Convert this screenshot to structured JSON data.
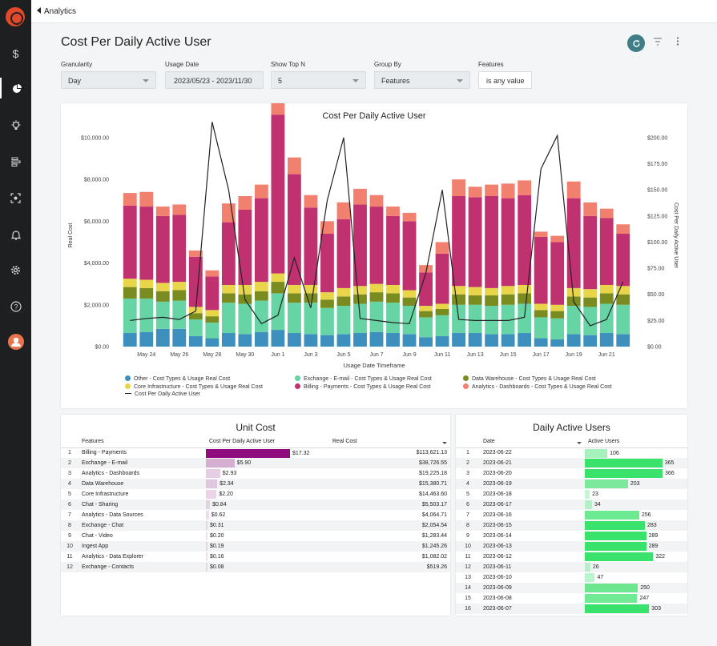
{
  "nav": {
    "back_label": "Analytics"
  },
  "page": {
    "title": "Cost Per Daily Active User"
  },
  "filters": [
    {
      "label": "Granularity",
      "value": "Day"
    },
    {
      "label": "Usage Date",
      "value": "2023/05/23 - 2023/11/30"
    },
    {
      "label": "Show Top N",
      "value": "5"
    },
    {
      "label": "Group By",
      "value": "Features"
    },
    {
      "label": "Features",
      "value": "is any value"
    }
  ],
  "colors": {
    "other": "#3d8fbd",
    "core_infrastructure": "#e8d54a",
    "exchange_email": "#67d4a6",
    "billing_payments": "#c0326f",
    "data_warehouse": "#7a8c20",
    "analytics_dashboards": "#f2806f",
    "accent": "#3f7e87",
    "unit_bar": "#8e0c7e",
    "dau_bar": "#39e26b"
  },
  "chart_data": {
    "type": "bar",
    "title": "Cost Per Daily Active User",
    "xlabel": "Usage Date Timeframe",
    "ylabel": "Real Cost",
    "y2label": "Cost Per Daily Active User",
    "ylim": [
      0,
      10800
    ],
    "y2lim": [
      0,
      216
    ],
    "y_ticks": [
      "$0.00",
      "$2,000.00",
      "$4,000.00",
      "$6,000.00",
      "$8,000.00",
      "$10,000.00"
    ],
    "y2_ticks": [
      "$0.00",
      "$25.00",
      "$50.00",
      "$75.00",
      "$100.00",
      "$125.00",
      "$150.00",
      "$175.00",
      "$200.00"
    ],
    "x_tick_labels": [
      "May 24",
      "May 26",
      "May 28",
      "May 30",
      "Jun 1",
      "Jun 3",
      "Jun 5",
      "Jun 7",
      "Jun 9",
      "Jun 11",
      "Jun 13",
      "Jun 15",
      "Jun 17",
      "Jun 19",
      "Jun 21"
    ],
    "x_tick_positions": [
      1,
      3,
      5,
      7,
      9,
      11,
      13,
      15,
      17,
      19,
      21,
      23,
      25,
      27,
      29
    ],
    "categories": [
      "2023-05-23",
      "2023-05-24",
      "2023-05-25",
      "2023-05-26",
      "2023-05-27",
      "2023-05-28",
      "2023-05-29",
      "2023-05-30",
      "2023-05-31",
      "2023-06-01",
      "2023-06-02",
      "2023-06-03",
      "2023-06-04",
      "2023-06-05",
      "2023-06-06",
      "2023-06-07",
      "2023-06-08",
      "2023-06-09",
      "2023-06-10",
      "2023-06-11",
      "2023-06-12",
      "2023-06-13",
      "2023-06-14",
      "2023-06-15",
      "2023-06-16",
      "2023-06-17",
      "2023-06-18",
      "2023-06-19",
      "2023-06-20",
      "2023-06-21",
      "2023-06-22"
    ],
    "stacked": true,
    "series": [
      {
        "name": "Other - Cost Types & Usage Real Cost",
        "color_key": "other",
        "values": [
          650,
          700,
          850,
          850,
          500,
          400,
          650,
          600,
          700,
          800,
          650,
          600,
          550,
          600,
          650,
          700,
          650,
          600,
          450,
          500,
          650,
          650,
          600,
          600,
          650,
          400,
          350,
          600,
          550,
          650,
          600
        ]
      },
      {
        "name": "Exchange - E-mail - Cost Types & Usage Real Cost",
        "color_key": "exchange_email",
        "values": [
          1650,
          1600,
          1300,
          1350,
          800,
          750,
          1450,
          1450,
          1500,
          1750,
          1450,
          1500,
          1300,
          1350,
          1400,
          1450,
          1450,
          1350,
          950,
          1000,
          1350,
          1350,
          1350,
          1400,
          1400,
          1000,
          1000,
          1350,
          1350,
          1400,
          1400
        ]
      },
      {
        "name": "Data Warehouse - Cost Types & Usage Real Cost",
        "color_key": "data_warehouse",
        "values": [
          550,
          500,
          500,
          500,
          300,
          300,
          450,
          450,
          450,
          550,
          450,
          450,
          400,
          450,
          450,
          450,
          450,
          400,
          300,
          300,
          500,
          450,
          500,
          500,
          500,
          350,
          350,
          450,
          450,
          500,
          500
        ]
      },
      {
        "name": "Core Infrastructure - Cost Types & Usage Real Cost",
        "color_key": "core_infrastructure",
        "values": [
          400,
          400,
          400,
          400,
          300,
          300,
          400,
          450,
          450,
          400,
          400,
          400,
          350,
          400,
          400,
          400,
          400,
          350,
          250,
          250,
          400,
          400,
          350,
          400,
          400,
          300,
          300,
          400,
          400,
          400,
          400
        ]
      },
      {
        "name": "Billing - Payments - Cost Types & Usage Real Cost",
        "color_key": "billing_payments",
        "values": [
          3500,
          3500,
          3200,
          3200,
          2400,
          1600,
          3000,
          3600,
          4000,
          7600,
          5300,
          3700,
          2800,
          3300,
          3900,
          3700,
          3300,
          3300,
          1600,
          2400,
          4300,
          4300,
          4400,
          4200,
          4300,
          3200,
          3000,
          4300,
          3500,
          3200,
          2500
        ]
      },
      {
        "name": "Analytics - Dashboards - Cost Types & Usage Real Cost",
        "color_key": "analytics_dashboards",
        "values": [
          600,
          700,
          450,
          500,
          300,
          300,
          900,
          650,
          650,
          600,
          800,
          600,
          600,
          800,
          750,
          550,
          450,
          400,
          350,
          550,
          800,
          500,
          550,
          700,
          700,
          250,
          300,
          800,
          650,
          450,
          450
        ]
      }
    ],
    "line_series": {
      "name": "Cost Per Daily Active User",
      "axis": "right",
      "values": [
        25,
        27,
        28,
        26,
        34,
        215,
        150,
        45,
        22,
        30,
        85,
        37,
        140,
        200,
        27,
        25,
        23,
        22,
        70,
        150,
        26,
        25,
        25,
        25,
        28,
        170,
        202,
        43,
        20,
        26,
        62
      ]
    }
  },
  "legend": [
    {
      "label": "Other - Cost Types & Usage Real Cost",
      "color_key": "other"
    },
    {
      "label": "Exchange - E-mail - Cost Types & Usage Real Cost",
      "color_key": "exchange_email"
    },
    {
      "label": "Data Warehouse - Cost Types & Usage Real Cost",
      "color_key": "data_warehouse"
    },
    {
      "label": "Core Infrastructure - Cost Types & Usage Real Cost",
      "color_key": "core_infrastructure"
    },
    {
      "label": "Billing - Payments - Cost Types & Usage Real Cost",
      "color_key": "billing_payments"
    },
    {
      "label": "Analytics - Dashboards - Cost Types & Usage Real Cost",
      "color_key": "analytics_dashboards"
    },
    {
      "label": "Cost Per Daily Active User",
      "color_key": "line"
    }
  ],
  "unit_cost": {
    "title": "Unit Cost",
    "columns": [
      "Features",
      "Cost Per Daily Active User",
      "Real Cost"
    ],
    "max_value": 17.32,
    "rows": [
      {
        "n": "1",
        "feature": "Billing - Payments",
        "cpdau": "$17.32",
        "cpdau_value": 17.32,
        "real": "$113,621.13"
      },
      {
        "n": "2",
        "feature": "Exchange - E-mail",
        "cpdau": "$5.90",
        "cpdau_value": 5.9,
        "real": "$38,726.55"
      },
      {
        "n": "3",
        "feature": "Analytics - Dashboards",
        "cpdau": "$2.93",
        "cpdau_value": 2.93,
        "real": "$19,225.18"
      },
      {
        "n": "4",
        "feature": "Data Warehouse",
        "cpdau": "$2.34",
        "cpdau_value": 2.34,
        "real": "$15,380.71"
      },
      {
        "n": "5",
        "feature": "Core Infrastructure",
        "cpdau": "$2.20",
        "cpdau_value": 2.2,
        "real": "$14,463.60"
      },
      {
        "n": "6",
        "feature": "Chat - Sharing",
        "cpdau": "$0.84",
        "cpdau_value": 0.84,
        "real": "$5,503.17"
      },
      {
        "n": "7",
        "feature": "Analytics - Data Sources",
        "cpdau": "$0.62",
        "cpdau_value": 0.62,
        "real": "$4,064.71"
      },
      {
        "n": "8",
        "feature": "Exchange - Chat",
        "cpdau": "$0.31",
        "cpdau_value": 0.31,
        "real": "$2,054.54"
      },
      {
        "n": "9",
        "feature": "Chat - Video",
        "cpdau": "$0.20",
        "cpdau_value": 0.2,
        "real": "$1,283.44"
      },
      {
        "n": "10",
        "feature": "Ingest App",
        "cpdau": "$0.19",
        "cpdau_value": 0.19,
        "real": "$1,245.26"
      },
      {
        "n": "11",
        "feature": "Analytics - Data Explorer",
        "cpdau": "$0.16",
        "cpdau_value": 0.16,
        "real": "$1,082.02"
      },
      {
        "n": "12",
        "feature": "Exchange - Contacts",
        "cpdau": "$0.08",
        "cpdau_value": 0.08,
        "real": "$519.26"
      }
    ]
  },
  "dau": {
    "title": "Daily Active Users",
    "columns": [
      "Date",
      "Active Users"
    ],
    "max_value": 366,
    "rows": [
      {
        "n": "1",
        "date": "2023-06-22",
        "users": "106",
        "value": 106
      },
      {
        "n": "2",
        "date": "2023-06-21",
        "users": "365",
        "value": 365
      },
      {
        "n": "3",
        "date": "2023-06-20",
        "users": "366",
        "value": 366
      },
      {
        "n": "4",
        "date": "2023-06-19",
        "users": "203",
        "value": 203
      },
      {
        "n": "5",
        "date": "2023-06-18",
        "users": "23",
        "value": 23
      },
      {
        "n": "6",
        "date": "2023-06-17",
        "users": "34",
        "value": 34
      },
      {
        "n": "7",
        "date": "2023-06-16",
        "users": "256",
        "value": 256
      },
      {
        "n": "8",
        "date": "2023-06-15",
        "users": "283",
        "value": 283
      },
      {
        "n": "9",
        "date": "2023-06-14",
        "users": "289",
        "value": 289
      },
      {
        "n": "10",
        "date": "2023-06-13",
        "users": "289",
        "value": 289
      },
      {
        "n": "11",
        "date": "2023-06-12",
        "users": "322",
        "value": 322
      },
      {
        "n": "12",
        "date": "2023-06-11",
        "users": "26",
        "value": 26
      },
      {
        "n": "13",
        "date": "2023-06-10",
        "users": "47",
        "value": 47
      },
      {
        "n": "14",
        "date": "2023-06-09",
        "users": "250",
        "value": 250
      },
      {
        "n": "15",
        "date": "2023-06-08",
        "users": "247",
        "value": 247
      },
      {
        "n": "16",
        "date": "2023-06-07",
        "users": "303",
        "value": 303
      }
    ]
  }
}
